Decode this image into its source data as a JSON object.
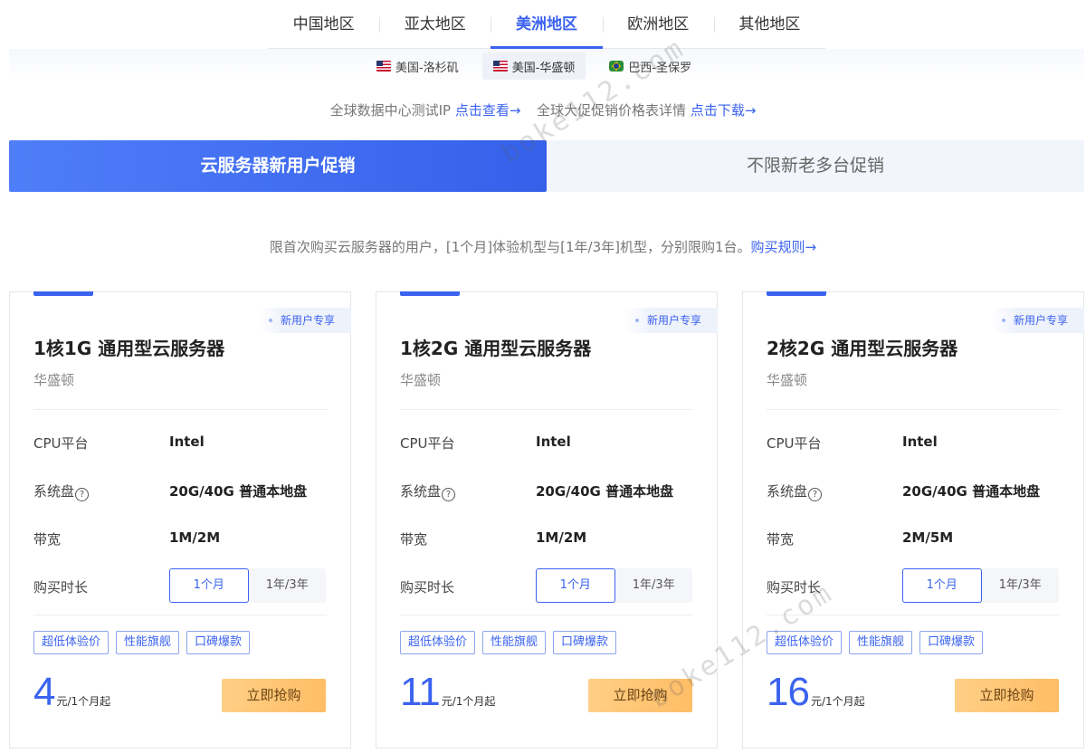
{
  "region_tabs": [
    "中国地区",
    "亚太地区",
    "美洲地区",
    "欧洲地区",
    "其他地区"
  ],
  "active_region_index": 2,
  "cities": [
    {
      "label": "美国-洛杉矶",
      "flag": "us-flag-icon"
    },
    {
      "label": "美国-华盛顿",
      "flag": "us-flag-icon"
    },
    {
      "label": "巴西-圣保罗",
      "flag": "brazil-flag-icon"
    }
  ],
  "active_city_index": 1,
  "info": {
    "ip_text": "全球数据中心测试IP",
    "ip_link": "点击查看→",
    "price_text": "全球大促促销价格表详情",
    "price_link": "点击下载→"
  },
  "promo_tabs": {
    "active": "云服务器新用户促销",
    "inactive": "不限新老多台促销"
  },
  "notice": {
    "text": "限首次购买云服务器的用户，[1个月]体验机型与[1年/3年]机型，分别限购1台。",
    "link": "购买规则→"
  },
  "spec_labels": {
    "cpu": "CPU平台",
    "disk": "系统盘",
    "bandwidth": "带宽",
    "duration": "购买时长"
  },
  "cards": [
    {
      "badge": "新用户专享",
      "title": "1核1G 通用型云服务器",
      "location": "华盛顿",
      "cpu": "Intel",
      "disk": "20G/40G 普通本地盘",
      "bandwidth": "1M/2M",
      "duration_options": [
        "1个月",
        "1年/3年"
      ],
      "tags": [
        "超低体验价",
        "性能旗舰",
        "口碑爆款"
      ],
      "price": "4",
      "price_unit": "元/1个月起",
      "buy_label": "立即抢购"
    },
    {
      "badge": "新用户专享",
      "title": "1核2G 通用型云服务器",
      "location": "华盛顿",
      "cpu": "Intel",
      "disk": "20G/40G 普通本地盘",
      "bandwidth": "1M/2M",
      "duration_options": [
        "1个月",
        "1年/3年"
      ],
      "tags": [
        "超低体验价",
        "性能旗舰",
        "口碑爆款"
      ],
      "price": "11",
      "price_unit": "元/1个月起",
      "buy_label": "立即抢购"
    },
    {
      "badge": "新用户专享",
      "title": "2核2G 通用型云服务器",
      "location": "华盛顿",
      "cpu": "Intel",
      "disk": "20G/40G 普通本地盘",
      "bandwidth": "2M/5M",
      "duration_options": [
        "1个月",
        "1年/3年"
      ],
      "tags": [
        "超低体验价",
        "性能旗舰",
        "口碑爆款"
      ],
      "price": "16",
      "price_unit": "元/1个月起",
      "buy_label": "立即抢购"
    }
  ],
  "watermark": "boke112.com",
  "colors": {
    "accent": "#3b63ef",
    "buy_button": "#ffbd66"
  }
}
